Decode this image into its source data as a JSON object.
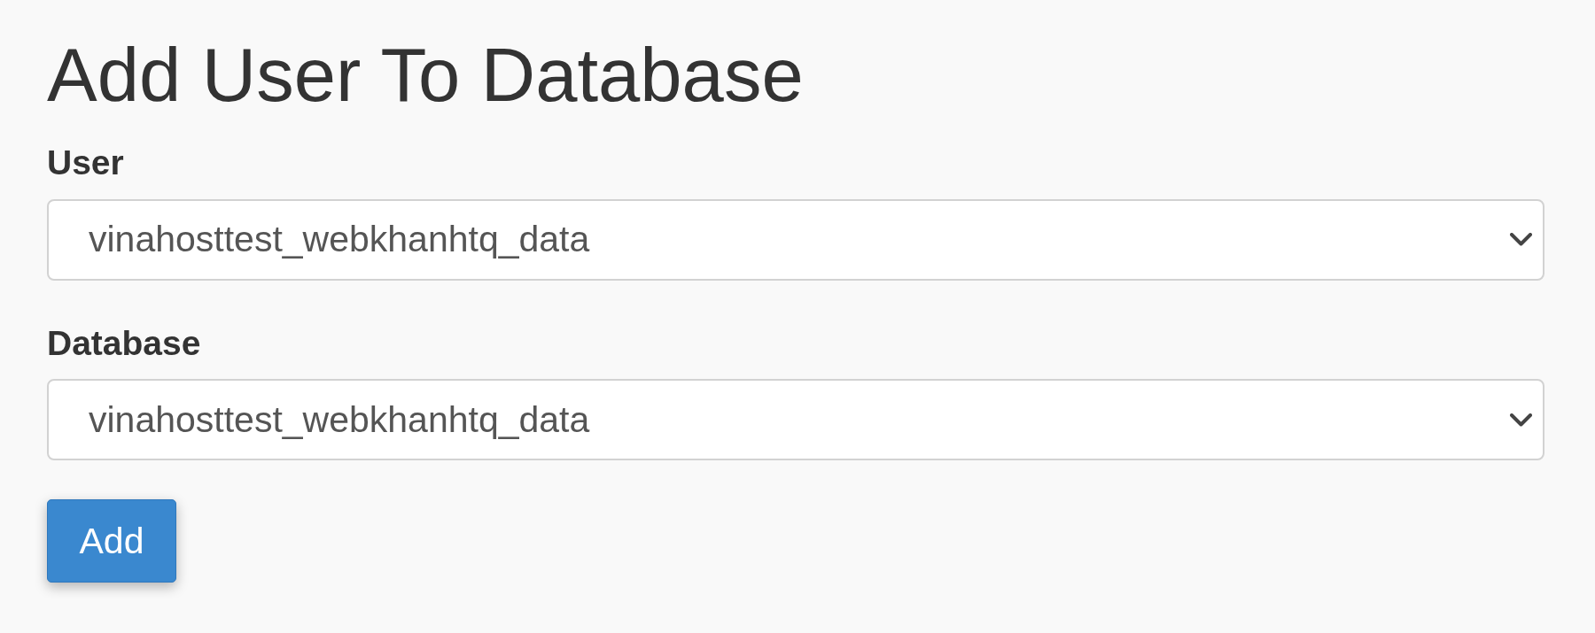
{
  "title": "Add User To Database",
  "fields": [
    {
      "label": "User",
      "value": "vinahosttest_webkhanhtq_data"
    },
    {
      "label": "Database",
      "value": "vinahosttest_webkhanhtq_data"
    }
  ],
  "add_button": {
    "label": "Add"
  }
}
